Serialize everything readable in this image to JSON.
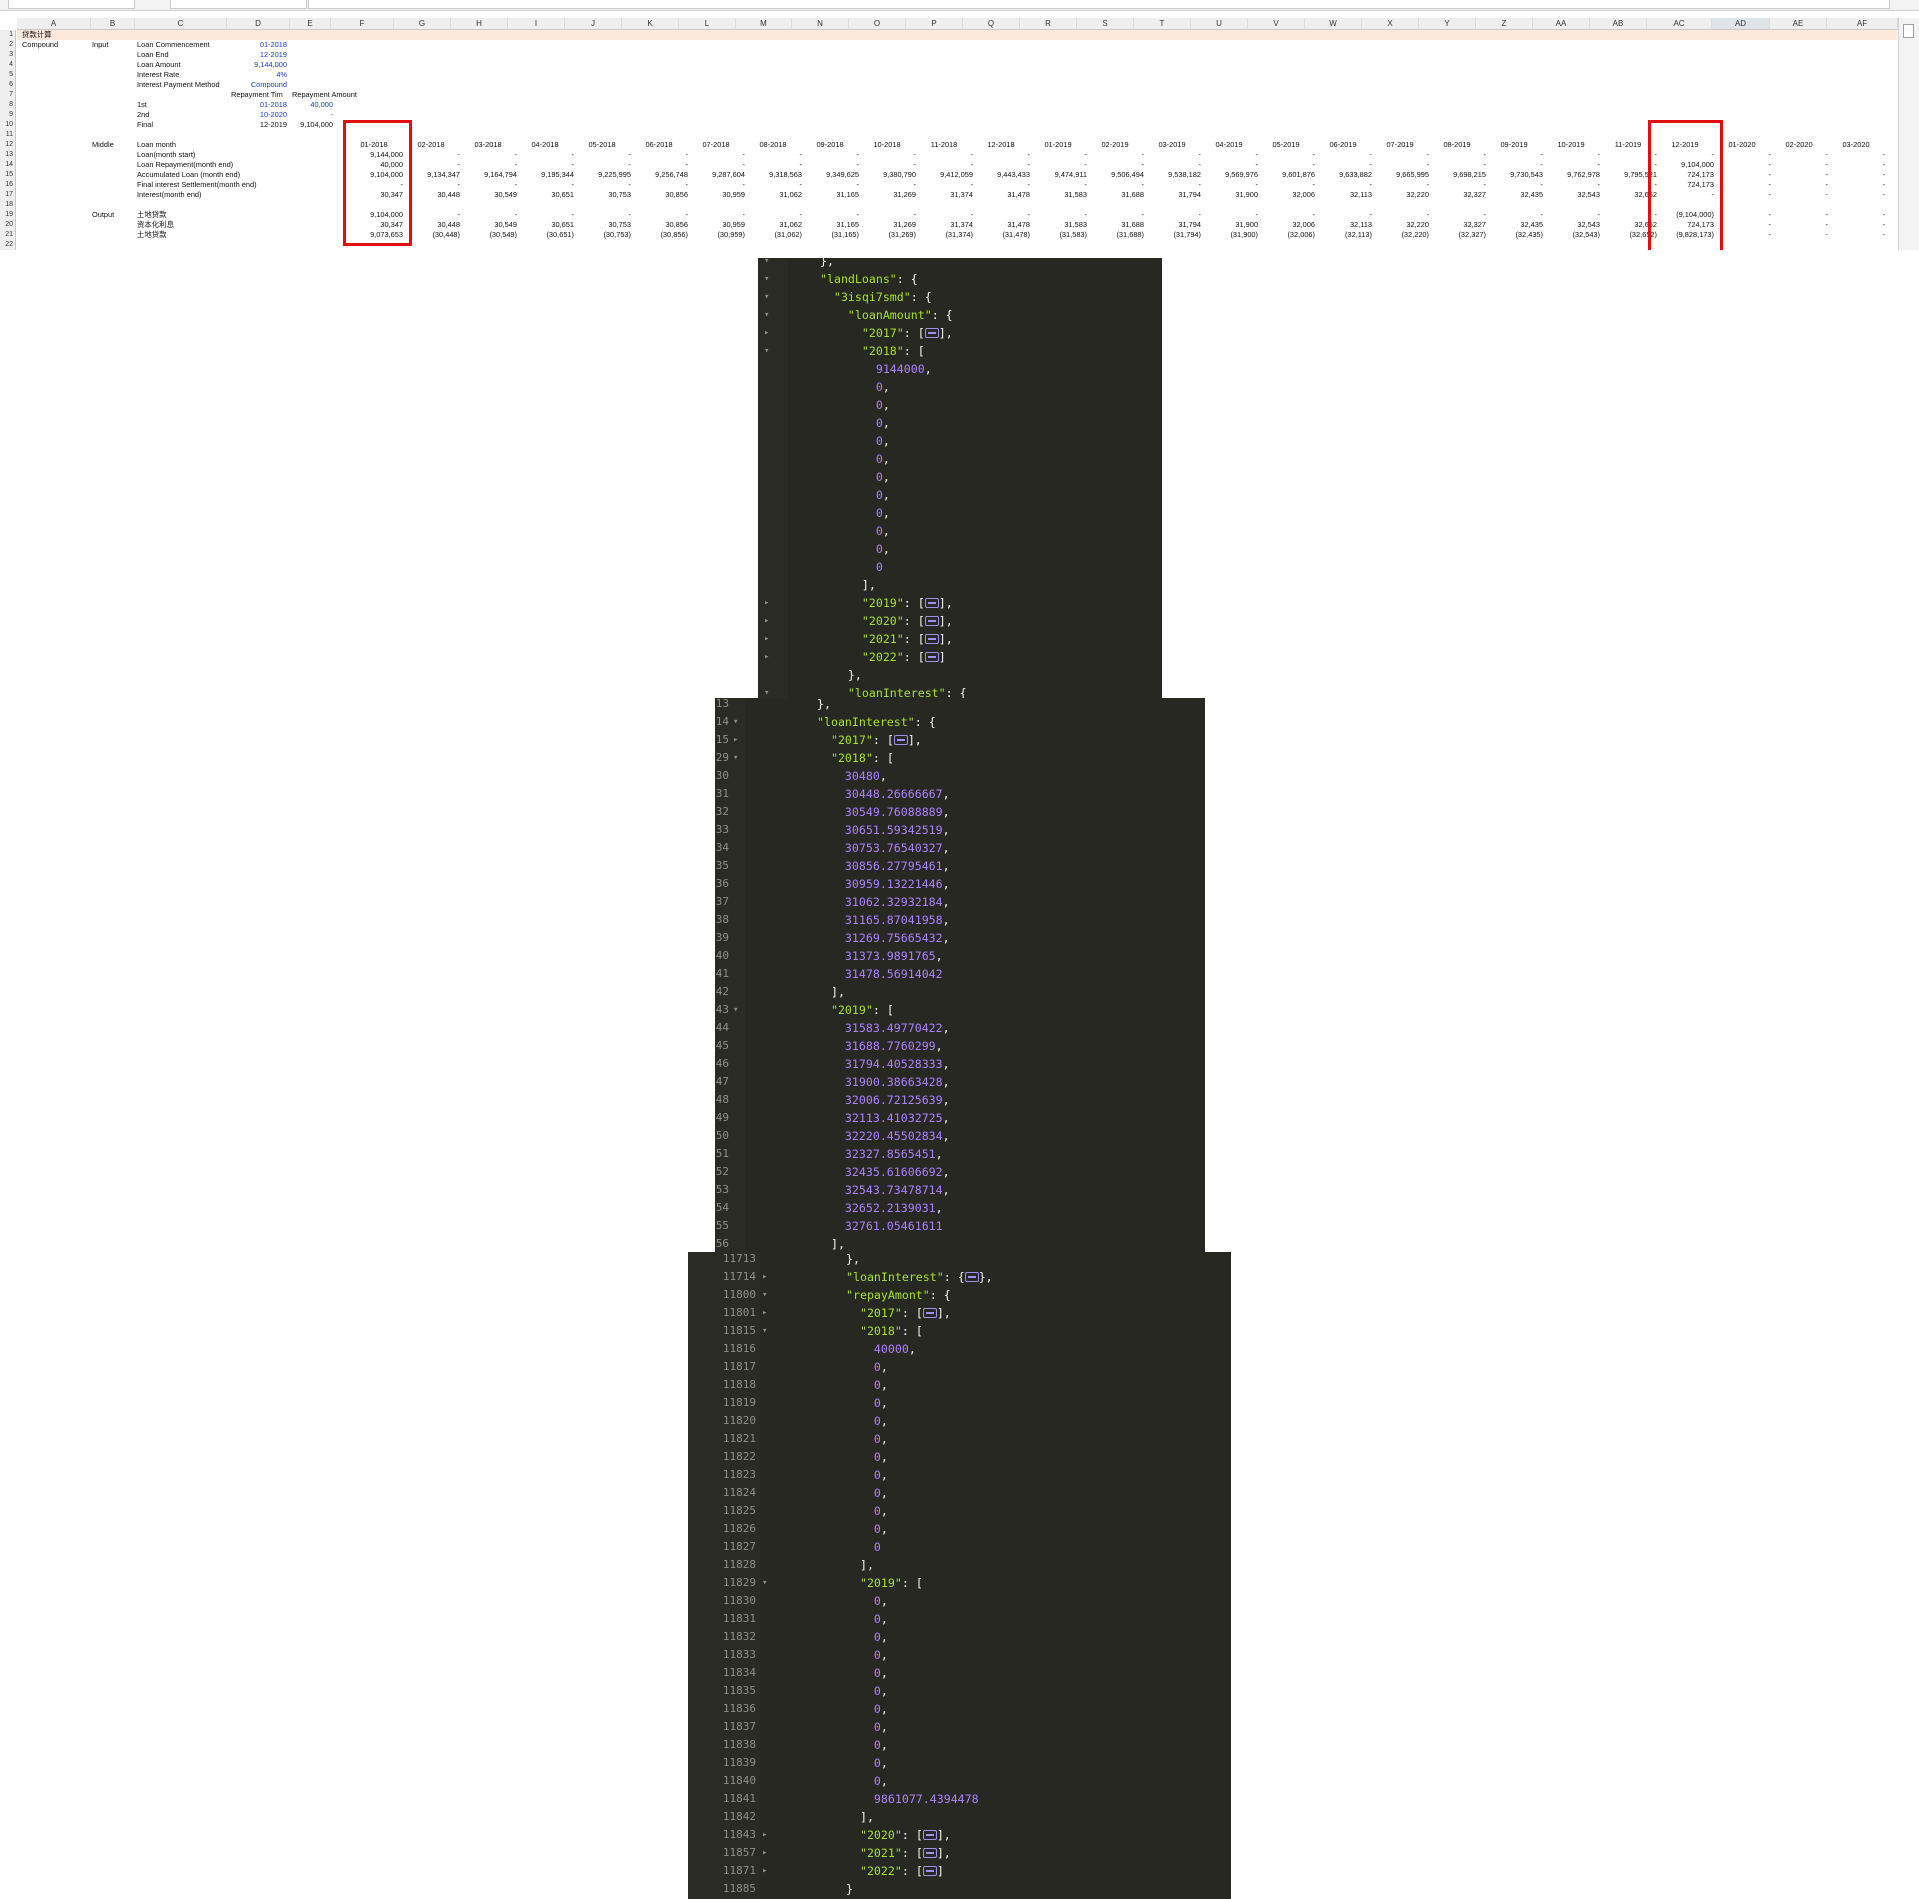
{
  "spreadsheet": {
    "columns": [
      "A",
      "B",
      "C",
      "D",
      "E",
      "F",
      "G",
      "H",
      "I",
      "J",
      "K",
      "L",
      "M",
      "N",
      "O",
      "P",
      "Q",
      "R",
      "S",
      "T",
      "U",
      "V",
      "W",
      "X",
      "Y",
      "Z",
      "AA",
      "AB",
      "AC",
      "AD",
      "AE",
      "AF"
    ],
    "selected_column": "AD",
    "row_numbers": [
      "1",
      "2",
      "3",
      "4",
      "5",
      "6",
      "7",
      "8",
      "9",
      "10",
      "11",
      "12",
      "13",
      "14",
      "15",
      "16",
      "17",
      "18",
      "19",
      "20",
      "21",
      "22"
    ],
    "title": "贷款计算",
    "section_compound": "Compound",
    "section_input": "Input",
    "section_middle": "Middle",
    "section_output": "Output",
    "input_rows": [
      {
        "label": "Loan Commencement",
        "value": "01-2018"
      },
      {
        "label": "Loan End",
        "value": "12-2019"
      },
      {
        "label": "Loan Amount",
        "value": "9,144,000"
      },
      {
        "label": "Interest Rate",
        "value": "4%"
      },
      {
        "label": "Interest Payment Method",
        "value": "Compound"
      }
    ],
    "repayment_header_time": "Repayment Tim",
    "repayment_header_amount": "Repayment Amount",
    "repayment_rows": [
      {
        "label": "1st",
        "time": "01-2018",
        "amount": "40,000",
        "blue": true
      },
      {
        "label": "2nd",
        "time": "10-2020",
        "amount": "-",
        "blue": true
      },
      {
        "label": "Final",
        "time": "12-2019",
        "amount": "9,104,000",
        "blue": false
      }
    ],
    "middle_labels": [
      "Loan month",
      "Loan(month start)",
      "Loan Repayment(month end)",
      "Accumulated Loan (month end)",
      "Final interest Settlement(month end)",
      "Interest(month end)"
    ],
    "output_labels": [
      "土地贷款",
      "资本化利息",
      "土地贷款"
    ],
    "months": [
      {
        "m": "01-2018",
        "start": "9,144,000",
        "repay": "40,000",
        "acc": "9,104,000",
        "final": "-",
        "int": "30,347",
        "o1": "9,104,000",
        "o2": "30,347",
        "o3": "9,073,653"
      },
      {
        "m": "02-2018",
        "start": "-",
        "repay": "-",
        "acc": "9,134,347",
        "final": "-",
        "int": "30,448",
        "o1": "-",
        "o2": "30,448",
        "o3": "(30,448)"
      },
      {
        "m": "03-2018",
        "start": "-",
        "repay": "-",
        "acc": "9,164,794",
        "final": "-",
        "int": "30,549",
        "o1": "-",
        "o2": "30,549",
        "o3": "(30,549)"
      },
      {
        "m": "04-2018",
        "start": "-",
        "repay": "-",
        "acc": "9,195,344",
        "final": "-",
        "int": "30,651",
        "o1": "-",
        "o2": "30,651",
        "o3": "(30,651)"
      },
      {
        "m": "05-2018",
        "start": "-",
        "repay": "-",
        "acc": "9,225,995",
        "final": "-",
        "int": "30,753",
        "o1": "-",
        "o2": "30,753",
        "o3": "(30,753)"
      },
      {
        "m": "06-2018",
        "start": "-",
        "repay": "-",
        "acc": "9,256,748",
        "final": "-",
        "int": "30,856",
        "o1": "-",
        "o2": "30,856",
        "o3": "(30,856)"
      },
      {
        "m": "07-2018",
        "start": "-",
        "repay": "-",
        "acc": "9,287,604",
        "final": "-",
        "int": "30,959",
        "o1": "-",
        "o2": "30,959",
        "o3": "(30,959)"
      },
      {
        "m": "08-2018",
        "start": "-",
        "repay": "-",
        "acc": "9,318,563",
        "final": "-",
        "int": "31,062",
        "o1": "-",
        "o2": "31,062",
        "o3": "(31,062)"
      },
      {
        "m": "09-2018",
        "start": "-",
        "repay": "-",
        "acc": "9,349,625",
        "final": "-",
        "int": "31,165",
        "o1": "-",
        "o2": "31,165",
        "o3": "(31,165)"
      },
      {
        "m": "10-2018",
        "start": "-",
        "repay": "-",
        "acc": "9,380,790",
        "final": "-",
        "int": "31,269",
        "o1": "-",
        "o2": "31,269",
        "o3": "(31,269)"
      },
      {
        "m": "11-2018",
        "start": "-",
        "repay": "-",
        "acc": "9,412,059",
        "final": "-",
        "int": "31,374",
        "o1": "-",
        "o2": "31,374",
        "o3": "(31,374)"
      },
      {
        "m": "12-2018",
        "start": "-",
        "repay": "-",
        "acc": "9,443,433",
        "final": "-",
        "int": "31,478",
        "o1": "-",
        "o2": "31,478",
        "o3": "(31,478)"
      },
      {
        "m": "01-2019",
        "start": "-",
        "repay": "-",
        "acc": "9,474,911",
        "final": "-",
        "int": "31,583",
        "o1": "-",
        "o2": "31,583",
        "o3": "(31,583)"
      },
      {
        "m": "02-2019",
        "start": "-",
        "repay": "-",
        "acc": "9,506,494",
        "final": "-",
        "int": "31,688",
        "o1": "-",
        "o2": "31,688",
        "o3": "(31,688)"
      },
      {
        "m": "03-2019",
        "start": "-",
        "repay": "-",
        "acc": "9,538,182",
        "final": "-",
        "int": "31,794",
        "o1": "-",
        "o2": "31,794",
        "o3": "(31,794)"
      },
      {
        "m": "04-2019",
        "start": "-",
        "repay": "-",
        "acc": "9,569,976",
        "final": "-",
        "int": "31,900",
        "o1": "-",
        "o2": "31,900",
        "o3": "(31,900)"
      },
      {
        "m": "05-2019",
        "start": "-",
        "repay": "-",
        "acc": "9,601,876",
        "final": "-",
        "int": "32,006",
        "o1": "-",
        "o2": "32,006",
        "o3": "(32,006)"
      },
      {
        "m": "06-2019",
        "start": "-",
        "repay": "-",
        "acc": "9,633,882",
        "final": "-",
        "int": "32,113",
        "o1": "-",
        "o2": "32,113",
        "o3": "(32,113)"
      },
      {
        "m": "07-2019",
        "start": "-",
        "repay": "-",
        "acc": "9,665,995",
        "final": "-",
        "int": "32,220",
        "o1": "-",
        "o2": "32,220",
        "o3": "(32,220)"
      },
      {
        "m": "08-2019",
        "start": "-",
        "repay": "-",
        "acc": "9,698,215",
        "final": "-",
        "int": "32,327",
        "o1": "-",
        "o2": "32,327",
        "o3": "(32,327)"
      },
      {
        "m": "09-2019",
        "start": "-",
        "repay": "-",
        "acc": "9,730,543",
        "final": "-",
        "int": "32,435",
        "o1": "-",
        "o2": "32,435",
        "o3": "(32,435)"
      },
      {
        "m": "10-2019",
        "start": "-",
        "repay": "-",
        "acc": "9,762,978",
        "final": "-",
        "int": "32,543",
        "o1": "-",
        "o2": "32,543",
        "o3": "(32,543)"
      },
      {
        "m": "11-2019",
        "start": "-",
        "repay": "-",
        "acc": "9,795,521",
        "final": "-",
        "int": "32,652",
        "o1": "-",
        "o2": "32,652",
        "o3": "(32,652)"
      },
      {
        "m": "12-2019",
        "start": "-",
        "repay": "9,104,000",
        "acc": "724,173",
        "final": "724,173",
        "int": "-",
        "o1": "(9,104,000)",
        "o2": "724,173",
        "o3": "(9,828,173)"
      },
      {
        "m": "01-2020",
        "start": "-",
        "repay": "-",
        "acc": "-",
        "final": "-",
        "int": "-",
        "o1": "-",
        "o2": "-",
        "o3": "-"
      },
      {
        "m": "02-2020",
        "start": "-",
        "repay": "-",
        "acc": "-",
        "final": "-",
        "int": "-",
        "o1": "-",
        "o2": "-",
        "o3": "-"
      },
      {
        "m": "03-2020",
        "start": "-",
        "repay": "-",
        "acc": "-",
        "final": "-",
        "int": "-",
        "o1": "-",
        "o2": "-",
        "o3": "-"
      }
    ]
  },
  "code_panel_1": {
    "lines": [
      {
        "text": "},",
        "fold": "▼"
      },
      {
        "text": "\"landLoans\": {",
        "fold": "▼"
      },
      {
        "text": "  \"3isqi7smd\": {",
        "fold": "▼"
      },
      {
        "text": "    \"loanAmount\": {",
        "fold": "▼"
      },
      {
        "text": "      \"2017\": [⇔],",
        "fold": "▶"
      },
      {
        "text": "      \"2018\": [",
        "fold": "▼"
      },
      {
        "text": "        9144000,",
        "fold": ""
      },
      {
        "text": "        0,",
        "fold": ""
      },
      {
        "text": "        0,",
        "fold": ""
      },
      {
        "text": "        0,",
        "fold": ""
      },
      {
        "text": "        0,",
        "fold": ""
      },
      {
        "text": "        0,",
        "fold": ""
      },
      {
        "text": "        0,",
        "fold": ""
      },
      {
        "text": "        0,",
        "fold": ""
      },
      {
        "text": "        0,",
        "fold": ""
      },
      {
        "text": "        0,",
        "fold": ""
      },
      {
        "text": "        0,",
        "fold": ""
      },
      {
        "text": "        0",
        "fold": ""
      },
      {
        "text": "      ],",
        "fold": ""
      },
      {
        "text": "      \"2019\": [⇔],",
        "fold": "▶"
      },
      {
        "text": "      \"2020\": [⇔],",
        "fold": "▶"
      },
      {
        "text": "      \"2021\": [⇔],",
        "fold": "▶"
      },
      {
        "text": "      \"2022\": [⇔]",
        "fold": "▶"
      },
      {
        "text": "    },",
        "fold": ""
      },
      {
        "text": "    \"loanInterest\": {",
        "fold": "▼"
      }
    ]
  },
  "code_panel_2": {
    "lines": [
      {
        "ln": "13",
        "text": "},",
        "fold": ""
      },
      {
        "ln": "14",
        "text": "\"loanInterest\": {",
        "fold": "▼"
      },
      {
        "ln": "15",
        "text": "  \"2017\": [⇔],",
        "fold": "▶"
      },
      {
        "ln": "29",
        "text": "  \"2018\": [",
        "fold": "▼"
      },
      {
        "ln": "30",
        "text": "    30480,",
        "fold": ""
      },
      {
        "ln": "31",
        "text": "    30448.26666667,",
        "fold": ""
      },
      {
        "ln": "32",
        "text": "    30549.76088889,",
        "fold": ""
      },
      {
        "ln": "33",
        "text": "    30651.59342519,",
        "fold": ""
      },
      {
        "ln": "34",
        "text": "    30753.76540327,",
        "fold": ""
      },
      {
        "ln": "35",
        "text": "    30856.27795461,",
        "fold": ""
      },
      {
        "ln": "36",
        "text": "    30959.13221446,",
        "fold": ""
      },
      {
        "ln": "37",
        "text": "    31062.32932184,",
        "fold": ""
      },
      {
        "ln": "38",
        "text": "    31165.87041958,",
        "fold": ""
      },
      {
        "ln": "39",
        "text": "    31269.75665432,",
        "fold": ""
      },
      {
        "ln": "40",
        "text": "    31373.9891765,",
        "fold": ""
      },
      {
        "ln": "41",
        "text": "    31478.56914042",
        "fold": ""
      },
      {
        "ln": "42",
        "text": "  ],",
        "fold": ""
      },
      {
        "ln": "43",
        "text": "  \"2019\": [",
        "fold": "▼"
      },
      {
        "ln": "44",
        "text": "    31583.49770422,",
        "fold": ""
      },
      {
        "ln": "45",
        "text": "    31688.7760299,",
        "fold": ""
      },
      {
        "ln": "46",
        "text": "    31794.40528333,",
        "fold": ""
      },
      {
        "ln": "47",
        "text": "    31900.38663428,",
        "fold": ""
      },
      {
        "ln": "48",
        "text": "    32006.72125639,",
        "fold": ""
      },
      {
        "ln": "49",
        "text": "    32113.41032725,",
        "fold": ""
      },
      {
        "ln": "50",
        "text": "    32220.45502834,",
        "fold": ""
      },
      {
        "ln": "51",
        "text": "    32327.8565451,",
        "fold": ""
      },
      {
        "ln": "52",
        "text": "    32435.61606692,",
        "fold": ""
      },
      {
        "ln": "53",
        "text": "    32543.73478714,",
        "fold": ""
      },
      {
        "ln": "54",
        "text": "    32652.2139031,",
        "fold": ""
      },
      {
        "ln": "55",
        "text": "    32761.05461611",
        "fold": ""
      },
      {
        "ln": "56",
        "text": "  ],",
        "fold": ""
      }
    ]
  },
  "code_panel_3": {
    "lines": [
      {
        "ln": "11713",
        "text": "},",
        "fold": ""
      },
      {
        "ln": "11714",
        "text": "\"loanInterest\": {⇔},",
        "fold": "▶"
      },
      {
        "ln": "11800",
        "text": "\"repayAmont\": {",
        "fold": "▼"
      },
      {
        "ln": "11801",
        "text": "  \"2017\": [⇔],",
        "fold": "▶"
      },
      {
        "ln": "11815",
        "text": "  \"2018\": [",
        "fold": "▼"
      },
      {
        "ln": "11816",
        "text": "    40000,",
        "fold": ""
      },
      {
        "ln": "11817",
        "text": "    0,",
        "fold": ""
      },
      {
        "ln": "11818",
        "text": "    0,",
        "fold": ""
      },
      {
        "ln": "11819",
        "text": "    0,",
        "fold": ""
      },
      {
        "ln": "11820",
        "text": "    0,",
        "fold": ""
      },
      {
        "ln": "11821",
        "text": "    0,",
        "fold": ""
      },
      {
        "ln": "11822",
        "text": "    0,",
        "fold": ""
      },
      {
        "ln": "11823",
        "text": "    0,",
        "fold": ""
      },
      {
        "ln": "11824",
        "text": "    0,",
        "fold": ""
      },
      {
        "ln": "11825",
        "text": "    0,",
        "fold": ""
      },
      {
        "ln": "11826",
        "text": "    0,",
        "fold": ""
      },
      {
        "ln": "11827",
        "text": "    0",
        "fold": ""
      },
      {
        "ln": "11828",
        "text": "  ],",
        "fold": ""
      },
      {
        "ln": "11829",
        "text": "  \"2019\": [",
        "fold": "▼"
      },
      {
        "ln": "11830",
        "text": "    0,",
        "fold": ""
      },
      {
        "ln": "11831",
        "text": "    0,",
        "fold": ""
      },
      {
        "ln": "11832",
        "text": "    0,",
        "fold": ""
      },
      {
        "ln": "11833",
        "text": "    0,",
        "fold": ""
      },
      {
        "ln": "11834",
        "text": "    0,",
        "fold": ""
      },
      {
        "ln": "11835",
        "text": "    0,",
        "fold": ""
      },
      {
        "ln": "11836",
        "text": "    0,",
        "fold": ""
      },
      {
        "ln": "11837",
        "text": "    0,",
        "fold": ""
      },
      {
        "ln": "11838",
        "text": "    0,",
        "fold": ""
      },
      {
        "ln": "11839",
        "text": "    0,",
        "fold": ""
      },
      {
        "ln": "11840",
        "text": "    0,",
        "fold": ""
      },
      {
        "ln": "11841",
        "text": "    9861077.4394478",
        "fold": ""
      },
      {
        "ln": "11842",
        "text": "  ],",
        "fold": ""
      },
      {
        "ln": "11843",
        "text": "  \"2020\": [⇔],",
        "fold": "▶"
      },
      {
        "ln": "11857",
        "text": "  \"2021\": [⇔],",
        "fold": "▶"
      },
      {
        "ln": "11871",
        "text": "  \"2022\": [⇔]",
        "fold": "▶"
      },
      {
        "ln": "11885",
        "text": "}",
        "fold": ""
      }
    ]
  },
  "colors": {
    "editor_bg": "#272822",
    "json_key": "#a6e22e",
    "json_number": "#ae81ff",
    "highlight_border": "#e01010",
    "input_value": "#1a3ccf",
    "title_band": "#fde9dc"
  }
}
